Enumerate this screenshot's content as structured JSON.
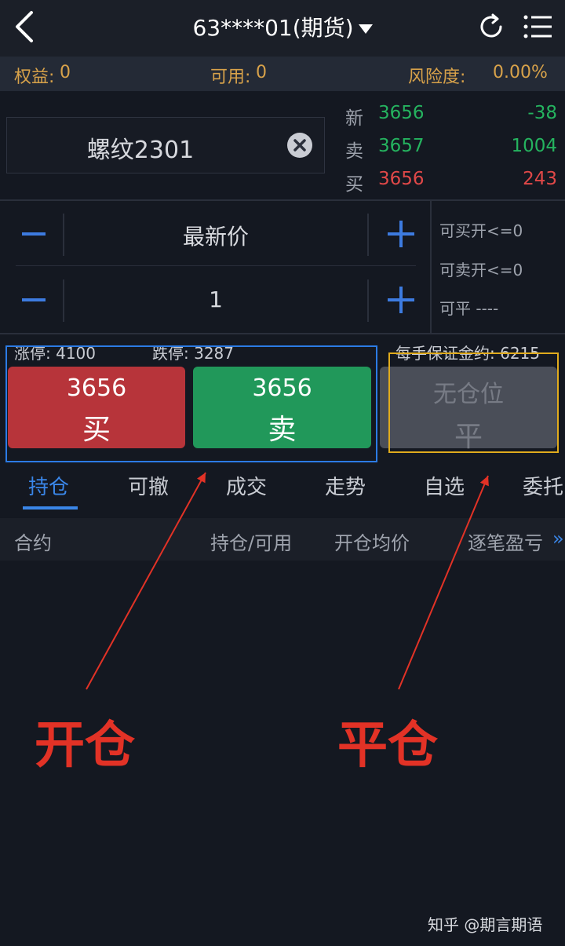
{
  "header": {
    "title": "63****01(期货)"
  },
  "account": {
    "equity_label": "权益:",
    "equity_value": "0",
    "available_label": "可用:",
    "available_value": "0",
    "risk_label": "风险度:",
    "risk_value": "0.00%"
  },
  "contract": {
    "name": "螺纹2301"
  },
  "quotes": [
    {
      "label": "新",
      "price": "3656",
      "change": "-38"
    },
    {
      "label": "卖",
      "price": "3657",
      "volume": "1004"
    },
    {
      "label": "买",
      "price": "3656",
      "volume": "243"
    }
  ],
  "order": {
    "price_mode": "最新价",
    "quantity": "1"
  },
  "availability": {
    "buy_open": "可买开<=0",
    "sell_open": "可卖开<=0",
    "close": "可平 ----"
  },
  "limits": {
    "up": "涨停: 4100",
    "down": "跌停: 3287",
    "margin": "每手保证金约: 6215"
  },
  "buttons": {
    "buy": {
      "price": "3656",
      "action": "买"
    },
    "sell": {
      "price": "3656",
      "action": "卖"
    },
    "close": {
      "status": "无仓位",
      "action": "平"
    }
  },
  "tabs": [
    "持仓",
    "可撤",
    "成交",
    "走势",
    "自选",
    "委托"
  ],
  "table_headers": [
    "合约",
    "持仓/可用",
    "开仓均价",
    "逐笔盈亏"
  ],
  "annotations": {
    "open": "开仓",
    "close": "平仓"
  },
  "watermark": "知乎 @期言期语",
  "colors": {
    "buy": "#b7343a",
    "sell": "#21985a",
    "accent": "#3a86e8",
    "annotation": "#e23226"
  }
}
